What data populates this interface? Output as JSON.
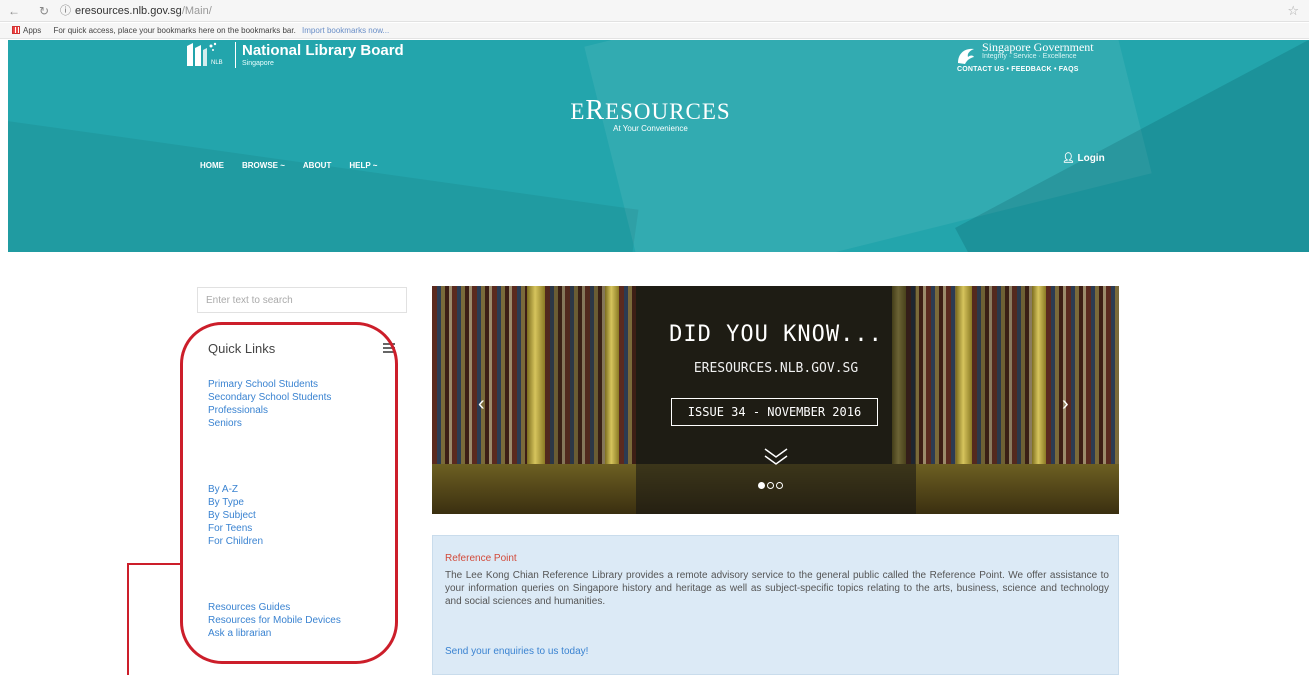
{
  "browser": {
    "url_host": "eresources.nlb.gov.sg",
    "url_path": "/Main/",
    "apps_label": "Apps",
    "bookmarks_hint": "For quick access, place your bookmarks here on the bookmarks bar.",
    "bookmarks_link": "Import bookmarks now..."
  },
  "header": {
    "org_name": "National Library Board",
    "org_sub": "Singapore",
    "gov_name": "Singapore Government",
    "gov_tagline": "Integrity · Service · Excellence",
    "gov_links": "CONTACT US • FEEDBACK • FAQS",
    "site_title_first": "E",
    "site_title_big": "R",
    "site_title_rest": "ESOURCES",
    "site_subtitle": "At Your Convenience",
    "nav": [
      "HOME",
      "BROWSE ~",
      "ABOUT",
      "HELP ~"
    ],
    "login_label": "Login"
  },
  "sidebar": {
    "search_placeholder": "Enter text to search",
    "quick_links_title": "Quick Links",
    "group1": [
      "Primary School Students",
      "Secondary School Students",
      "Professionals",
      "Seniors"
    ],
    "group2": [
      "By A-Z",
      "By Type",
      "By Subject",
      "For Teens",
      "For Children"
    ],
    "group3": [
      "Resources Guides",
      "Resources for Mobile Devices",
      "Ask a librarian"
    ]
  },
  "banner": {
    "line1": "DID YOU KNOW...",
    "line2": "ERESOURCES.NLB.GOV.SG",
    "line3": "ISSUE 34 - NOVEMBER 2016",
    "slides": 3,
    "active_slide": 1
  },
  "reference": {
    "title": "Reference Point",
    "body": "The Lee Kong Chian Reference Library provides a remote advisory service to the general public called the Reference Point. We offer assistance to your information queries on Singapore history and heritage as well as subject-specific topics relating to the arts, business, science and technology and social sciences and humanities.",
    "link": "Send your enquiries to us today!"
  },
  "colors": {
    "header_teal": "#23a5ac",
    "link_blue": "#3a83d1",
    "highlight_red": "#cc1e2a",
    "ref_box_bg": "#dceaf6"
  }
}
